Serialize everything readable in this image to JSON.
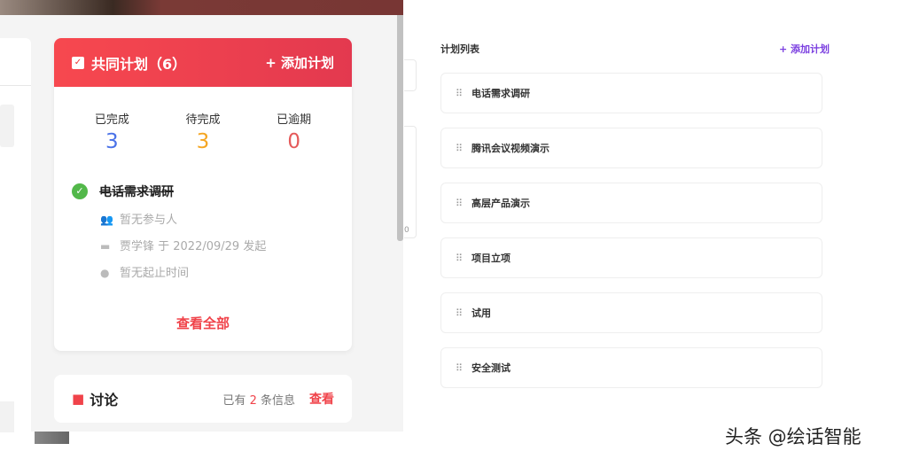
{
  "plan_card": {
    "title": "共同计划（6）",
    "add_label": "+ 添加计划",
    "stats": [
      {
        "label": "已完成",
        "value": "3",
        "color": "#4a72e8"
      },
      {
        "label": "待完成",
        "value": "3",
        "color": "#f5a623"
      },
      {
        "label": "已逾期",
        "value": "0",
        "color": "#e55a5a"
      }
    ],
    "task": {
      "name": "电话需求调研",
      "participants": "暂无参与人",
      "initiated": "贾学锋 于 2022/09/29 发起",
      "time": "暂无起止时间"
    },
    "view_all": "查看全部"
  },
  "discussion": {
    "title": "讨论",
    "info_prefix": "已有",
    "count": "2",
    "info_suffix": "条信息",
    "view": "查看"
  },
  "side_stub_text": "0",
  "plan_list": {
    "title": "计划列表",
    "add_label": "+ 添加计划",
    "items": [
      "电话需求调研",
      "腾讯会议视频演示",
      "高层产品演示",
      "项目立项",
      "试用",
      "安全测试"
    ]
  },
  "watermark": "头条 @绘话智能"
}
